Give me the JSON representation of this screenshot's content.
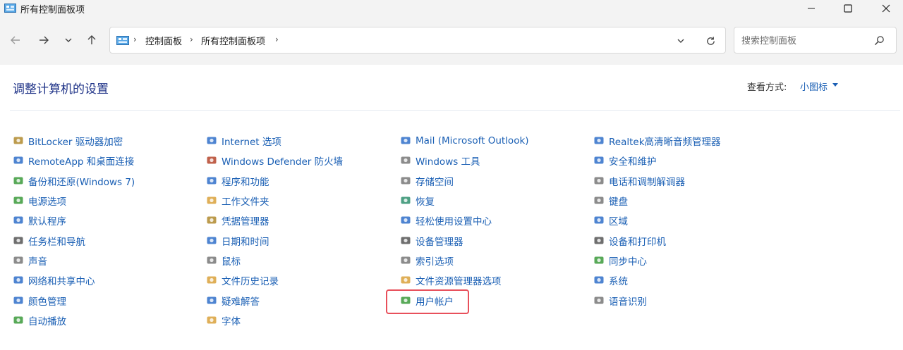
{
  "window": {
    "title": "所有控制面板项",
    "controls": {
      "minimize": "—",
      "maximize": "☐",
      "close": "✕"
    }
  },
  "nav": {
    "back_icon": "arrow-left-icon",
    "forward_icon": "arrow-right-icon",
    "recent_icon": "chevron-down-icon",
    "up_icon": "arrow-up-icon",
    "breadcrumb": [
      "控制面板",
      "所有控制面板项"
    ],
    "search_placeholder": "搜索控制面板"
  },
  "content": {
    "heading": "调整计算机的设置",
    "view_by_label": "查看方式:",
    "view_by_value": "小图标"
  },
  "columns": [
    [
      {
        "label": "BitLocker 驱动器加密",
        "icon": "bitlocker-icon",
        "color": "#b08a2e"
      },
      {
        "label": "RemoteApp 和桌面连接",
        "icon": "remoteapp-icon",
        "color": "#2f6fc9"
      },
      {
        "label": "备份和还原(Windows 7)",
        "icon": "backup-icon",
        "color": "#3b9a3b"
      },
      {
        "label": "电源选项",
        "icon": "power-icon",
        "color": "#3b9a3b"
      },
      {
        "label": "默认程序",
        "icon": "default-programs-icon",
        "color": "#2f6fc9"
      },
      {
        "label": "任务栏和导航",
        "icon": "taskbar-icon",
        "color": "#555555"
      },
      {
        "label": "声音",
        "icon": "sound-icon",
        "color": "#777777"
      },
      {
        "label": "网络和共享中心",
        "icon": "network-icon",
        "color": "#2f6fc9"
      },
      {
        "label": "颜色管理",
        "icon": "color-management-icon",
        "color": "#2f6fc9"
      },
      {
        "label": "自动播放",
        "icon": "autoplay-icon",
        "color": "#3b9a3b"
      }
    ],
    [
      {
        "label": "Internet 选项",
        "icon": "internet-options-icon",
        "color": "#2f6fc9"
      },
      {
        "label": "Windows Defender 防火墙",
        "icon": "firewall-icon",
        "color": "#b5452b"
      },
      {
        "label": "程序和功能",
        "icon": "programs-icon",
        "color": "#2f6fc9"
      },
      {
        "label": "工作文件夹",
        "icon": "work-folders-icon",
        "color": "#d9a13b"
      },
      {
        "label": "凭据管理器",
        "icon": "credential-icon",
        "color": "#b08a2e"
      },
      {
        "label": "日期和时间",
        "icon": "date-time-icon",
        "color": "#2f6fc9"
      },
      {
        "label": "鼠标",
        "icon": "mouse-icon",
        "color": "#777777"
      },
      {
        "label": "文件历史记录",
        "icon": "file-history-icon",
        "color": "#d9a13b"
      },
      {
        "label": "疑难解答",
        "icon": "troubleshoot-icon",
        "color": "#2f6fc9"
      },
      {
        "label": "字体",
        "icon": "fonts-icon",
        "color": "#d9a13b"
      }
    ],
    [
      {
        "label": "Mail (Microsoft Outlook)",
        "icon": "mail-icon",
        "color": "#2f6fc9"
      },
      {
        "label": "Windows 工具",
        "icon": "windows-tools-icon",
        "color": "#777777"
      },
      {
        "label": "存储空间",
        "icon": "storage-icon",
        "color": "#777777"
      },
      {
        "label": "恢复",
        "icon": "recovery-icon",
        "color": "#2f8f6f"
      },
      {
        "label": "轻松使用设置中心",
        "icon": "ease-of-access-icon",
        "color": "#2f6fc9"
      },
      {
        "label": "设备管理器",
        "icon": "device-manager-icon",
        "color": "#555555"
      },
      {
        "label": "索引选项",
        "icon": "indexing-icon",
        "color": "#777777"
      },
      {
        "label": "文件资源管理器选项",
        "icon": "explorer-options-icon",
        "color": "#d9a13b"
      },
      {
        "label": "用户帐户",
        "icon": "user-accounts-icon",
        "color": "#3b9a3b"
      }
    ],
    [
      {
        "label": "Realtek高清晰音频管理器",
        "icon": "realtek-audio-icon",
        "color": "#2f6fc9"
      },
      {
        "label": "安全和维护",
        "icon": "security-flag-icon",
        "color": "#2f6fc9"
      },
      {
        "label": "电话和调制解调器",
        "icon": "phone-modem-icon",
        "color": "#777777"
      },
      {
        "label": "键盘",
        "icon": "keyboard-icon",
        "color": "#777777"
      },
      {
        "label": "区域",
        "icon": "region-icon",
        "color": "#2f6fc9"
      },
      {
        "label": "设备和打印机",
        "icon": "printer-icon",
        "color": "#555555"
      },
      {
        "label": "同步中心",
        "icon": "sync-center-icon",
        "color": "#3b9a3b"
      },
      {
        "label": "系统",
        "icon": "system-icon",
        "color": "#2f6fc9"
      },
      {
        "label": "语音识别",
        "icon": "microphone-icon",
        "color": "#777777"
      }
    ]
  ],
  "highlighted_item": "用户帐户"
}
